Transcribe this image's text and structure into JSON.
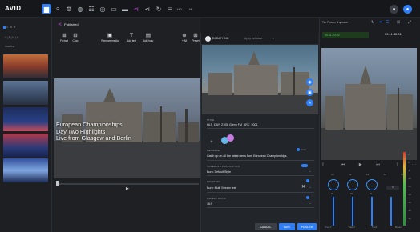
{
  "app": {
    "logo": "AVID",
    "top_tools": [
      "folder-icon",
      "search-icon",
      "settings-icon",
      "globe-icon",
      "sliders-icon",
      "badge-icon",
      "monitor-icon",
      "video-icon",
      "share-icon",
      "refresh-icon",
      "split-icon"
    ],
    "top_small_labels": [
      "HD",
      "4K"
    ]
  },
  "left": {
    "header_label": "Published",
    "nav_row": "V | P | M | X",
    "sub_row": "Assets ▸"
  },
  "center": {
    "tools": [
      {
        "label": "Format",
        "icon": "⊞"
      },
      {
        "label": "Crop",
        "icon": "⊟"
      },
      {
        "label": "Remove media",
        "icon": "▣"
      },
      {
        "label": "Add text",
        "icon": "T"
      },
      {
        "label": "Add logo",
        "icon": "▤"
      }
    ],
    "right_tools": [
      {
        "label": "+ All",
        "icon": "⊕"
      },
      {
        "label": "Preset",
        "icon": "⊞"
      }
    ],
    "overlay_lines": [
      "European Championships",
      "Day Two Highlights",
      "Live from Glasgow and Berlin"
    ]
  },
  "meta": {
    "header_user": "DISNEY INC",
    "header_dropdown": "Apply metadata",
    "title_label": "TITLE",
    "title_value": "HLS_DAY_2105: Glenn FM_ARC_2001",
    "message_label": "MESSAGE",
    "message_value": "Catch up on all the latest news from European Championships.",
    "publish_label": "SCHEDULE PUBLICATION",
    "publish_value": "Burn: Default Style",
    "location_label": "LOCATION",
    "location_value": "Burn: Multi Stream test",
    "aspect_label": "ASPECT RATIO",
    "aspect_value": "16:9",
    "toggle_label": "Auto",
    "cancel": "CANCEL",
    "save": "SAVE",
    "publish": "PUBLISH"
  },
  "right": {
    "source_label": "Tim Prosser & speaker",
    "timecode_left": "00:11:20:02",
    "timecode_right": "00:11:40:01",
    "channel_labels": [
      "A1",
      "A2",
      "A3",
      "A4",
      "Mix"
    ],
    "knob_labels": [
      "IN",
      "IN",
      "IN"
    ],
    "fader_labels": [
      "Track 1",
      "Track 2",
      "Track 3",
      "Master"
    ],
    "db_scale": [
      "+6",
      "0",
      "-6",
      "-12",
      "-18",
      "-24",
      "-30",
      "-42",
      "-60"
    ]
  },
  "colors": {
    "accent": "#2f7ef6",
    "magenta": "#c04ad6",
    "green": "#5ec25e"
  }
}
